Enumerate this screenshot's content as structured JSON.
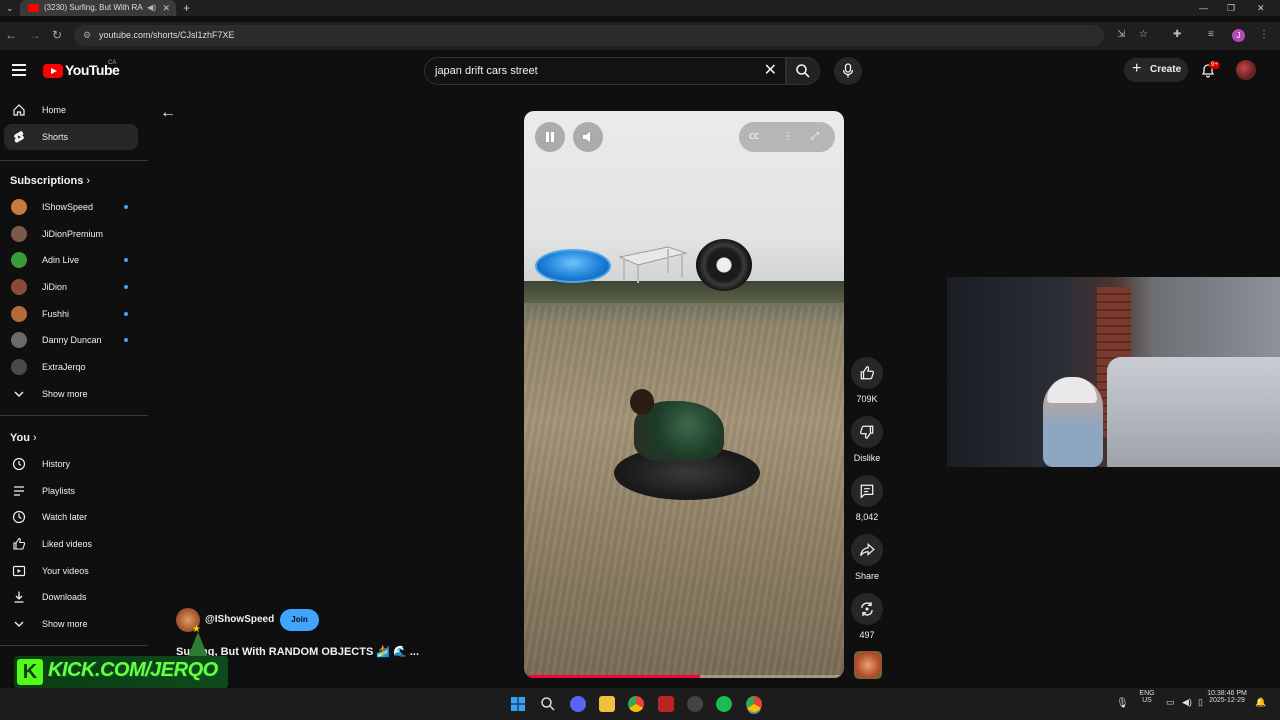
{
  "browser": {
    "tab_title": "(3230) Surfing, But With RA",
    "url": "youtube.com/shorts/CJsl1zhF7XE"
  },
  "header": {
    "logo_text": "YouTube",
    "country": "CA",
    "search_value": "japan drift cars street",
    "create_label": "Create",
    "notifications_badge": "9+",
    "profile_initial": "J"
  },
  "sidebar": {
    "home": "Home",
    "shorts": "Shorts",
    "subscriptions_heading": "Subscriptions",
    "subscriptions": [
      {
        "name": "IShowSpeed",
        "color": "#c77a3d"
      },
      {
        "name": "JiDionPremium",
        "color": "#7a5a4a"
      },
      {
        "name": "Adin Live",
        "color": "#3a9a3a"
      },
      {
        "name": "JiDion",
        "color": "#8a4a3a"
      },
      {
        "name": "Fushhi",
        "color": "#b46a3a"
      },
      {
        "name": "Danny Duncan",
        "color": "#6a6a6a"
      },
      {
        "name": "ExtraJerqo",
        "color": "#4a4a4a"
      }
    ],
    "show_more_1": "Show more",
    "you_heading": "You",
    "you_items": [
      "History",
      "Playlists",
      "Watch later",
      "Liked videos",
      "Your videos",
      "Downloads"
    ],
    "show_more_2": "Show more"
  },
  "short": {
    "progress": 0.55,
    "channel": "@IShowSpeed",
    "join_label": "Join",
    "title": "Surfing, But With RANDOM OBJECTS 🏄 🌊 ...",
    "likes": "709K",
    "dislike_label": "Dislike",
    "comments": "8,042",
    "share_label": "Share",
    "remix_count": "497"
  },
  "overlay": {
    "kick_text": "KICK.COM/JERQO"
  },
  "taskbar": {
    "lang_top": "ENG",
    "lang_bottom": "US",
    "time": "10:38:46 PM",
    "date": "2025-12-29"
  }
}
